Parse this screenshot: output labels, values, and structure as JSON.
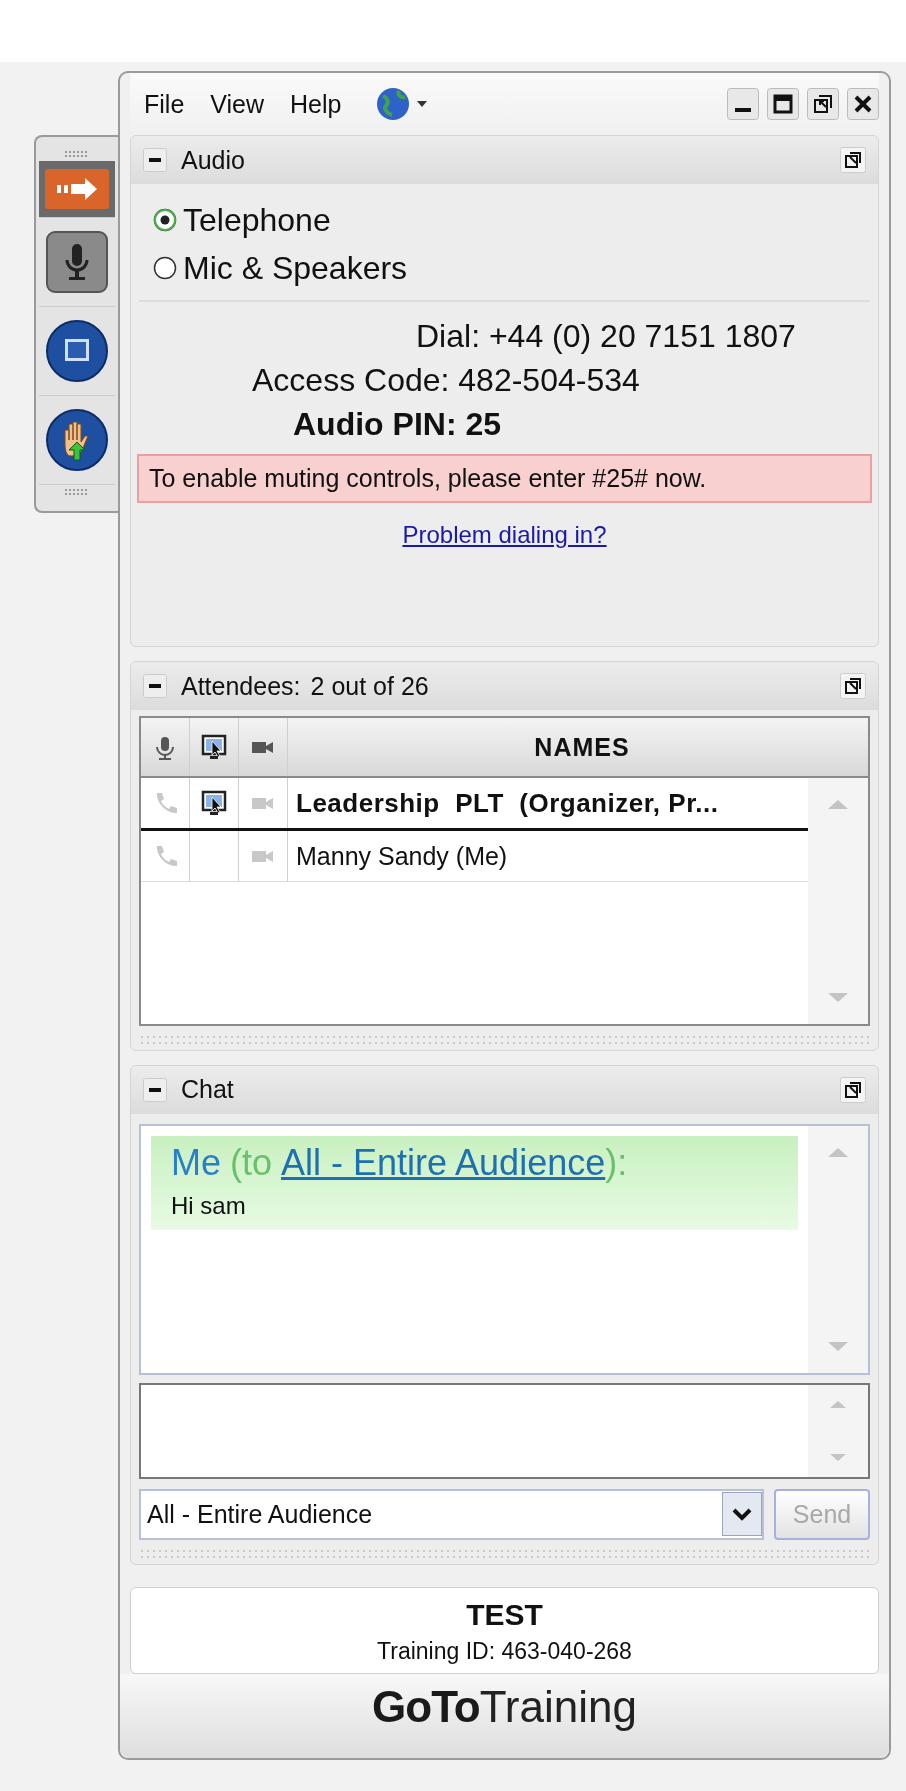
{
  "menu": [
    "File",
    "View",
    "Help"
  ],
  "toolbar": [
    {
      "kind": "arrow",
      "selected": true
    },
    {
      "kind": "mic",
      "selected": false
    },
    {
      "kind": "screen",
      "selected": false
    },
    {
      "kind": "hand",
      "selected": false
    }
  ],
  "audio": {
    "title": "Audio",
    "options": [
      {
        "label": "Telephone",
        "selected": true
      },
      {
        "label": "Mic & Speakers",
        "selected": false
      }
    ],
    "lines": [
      {
        "kind": "dial",
        "text": "Dial: +44 (0) 20 7151 1807"
      },
      {
        "kind": "access",
        "text": "Access Code: 482-504-534"
      },
      {
        "kind": "pin",
        "text": "Audio PIN: 25"
      }
    ],
    "notice": "To enable muting controls, please enter #25# now.",
    "help_link": "Problem dialing in?"
  },
  "attendees": {
    "title": "Attendees:",
    "count": "2 out of 26",
    "names_header": "NAMES",
    "rows": [
      {
        "name": "Leadership  PLT  (Organizer, Pr...",
        "organizer": true,
        "presenter": true
      },
      {
        "name": "Manny Sandy (Me)",
        "organizer": false,
        "presenter": false
      }
    ]
  },
  "chat": {
    "title": "Chat",
    "messages": [
      {
        "sender": "Me",
        "prefix": "(to",
        "recipient": "All - Entire Audience",
        "suffix": "):",
        "text": "Hi sam"
      }
    ],
    "recipient_select": "All - Entire Audience",
    "send": {
      "label": "Send",
      "disabled": true
    }
  },
  "session": {
    "title": "TEST",
    "training_id": "Training ID: 463-040-268"
  },
  "brand": {
    "bold": "GoTo",
    "light": "Training"
  }
}
